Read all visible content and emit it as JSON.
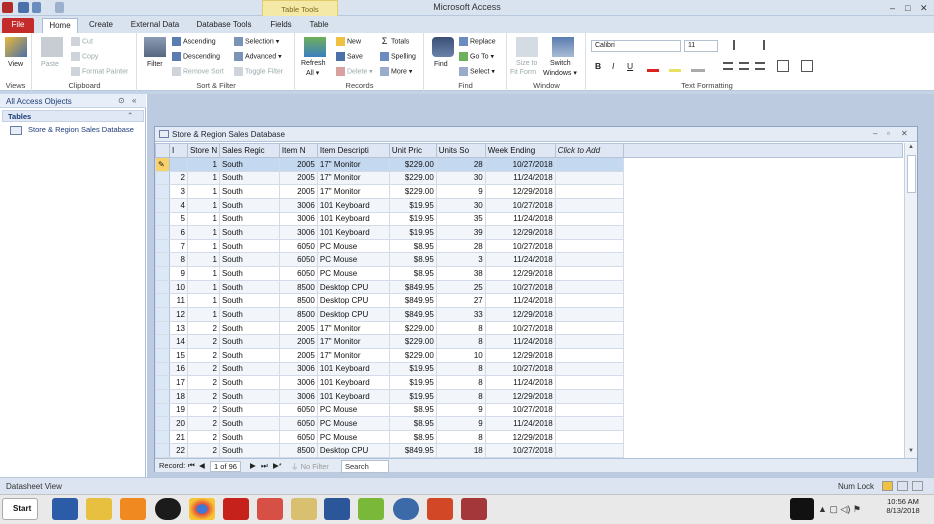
{
  "app": {
    "title": "Microsoft Access",
    "context_tab_group": "Table Tools"
  },
  "tabs": [
    "File",
    "Home",
    "Create",
    "External Data",
    "Database Tools",
    "Fields",
    "Table"
  ],
  "ribbon": {
    "views": {
      "label": "Views",
      "view": "View"
    },
    "clipboard": {
      "label": "Clipboard",
      "paste": "Paste",
      "cut": "Cut",
      "copy": "Copy",
      "format_painter": "Format Painter"
    },
    "sort_filter": {
      "label": "Sort & Filter",
      "filter": "Filter",
      "ascending": "Ascending",
      "descending": "Descending",
      "remove_sort": "Remove Sort",
      "selection": "Selection ▾",
      "advanced": "Advanced ▾",
      "toggle_filter": "Toggle Filter"
    },
    "records": {
      "label": "Records",
      "refresh": "Refresh",
      "refresh2": "All ▾",
      "new": "New",
      "save": "Save",
      "delete": "Delete ▾",
      "totals": "Totals",
      "spelling": "Spelling",
      "more": "More ▾"
    },
    "find": {
      "label": "Find",
      "find": "Find",
      "replace": "Replace",
      "goto": "Go To ▾",
      "select": "Select ▾"
    },
    "window": {
      "label": "Window",
      "size_to_fit": "Size to",
      "size_to_fit2": "Fit Form",
      "switch": "Switch",
      "switch2": "Windows ▾"
    },
    "text_formatting": {
      "label": "Text Formatting",
      "font": "Calibri",
      "size": "11",
      "bold": "B",
      "italic": "I",
      "underline": "U"
    }
  },
  "nav": {
    "header": "All Access Objects",
    "section": "Tables",
    "items": [
      "Store & Region Sales Database"
    ]
  },
  "document": {
    "title": "Store & Region Sales Database"
  },
  "grid": {
    "columns": [
      "I",
      "Store N",
      "Sales Regic",
      "Item N",
      "Item Descripti",
      "Unit Pric",
      "Units So",
      "Week Ending",
      "Click to Add"
    ],
    "rows": [
      [
        "",
        "1",
        "South",
        "2005",
        "17\" Monitor",
        "$229.00",
        "28",
        "10/27/2018"
      ],
      [
        "2",
        "1",
        "South",
        "2005",
        "17\" Monitor",
        "$229.00",
        "30",
        "11/24/2018"
      ],
      [
        "3",
        "1",
        "South",
        "2005",
        "17\" Monitor",
        "$229.00",
        "9",
        "12/29/2018"
      ],
      [
        "4",
        "1",
        "South",
        "3006",
        "101 Keyboard",
        "$19.95",
        "30",
        "10/27/2018"
      ],
      [
        "5",
        "1",
        "South",
        "3006",
        "101 Keyboard",
        "$19.95",
        "35",
        "11/24/2018"
      ],
      [
        "6",
        "1",
        "South",
        "3006",
        "101 Keyboard",
        "$19.95",
        "39",
        "12/29/2018"
      ],
      [
        "7",
        "1",
        "South",
        "6050",
        "PC Mouse",
        "$8.95",
        "28",
        "10/27/2018"
      ],
      [
        "8",
        "1",
        "South",
        "6050",
        "PC Mouse",
        "$8.95",
        "3",
        "11/24/2018"
      ],
      [
        "9",
        "1",
        "South",
        "6050",
        "PC Mouse",
        "$8.95",
        "38",
        "12/29/2018"
      ],
      [
        "10",
        "1",
        "South",
        "8500",
        "Desktop CPU",
        "$849.95",
        "25",
        "10/27/2018"
      ],
      [
        "11",
        "1",
        "South",
        "8500",
        "Desktop CPU",
        "$849.95",
        "27",
        "11/24/2018"
      ],
      [
        "12",
        "1",
        "South",
        "8500",
        "Desktop CPU",
        "$849.95",
        "33",
        "12/29/2018"
      ],
      [
        "13",
        "2",
        "South",
        "2005",
        "17\" Monitor",
        "$229.00",
        "8",
        "10/27/2018"
      ],
      [
        "14",
        "2",
        "South",
        "2005",
        "17\" Monitor",
        "$229.00",
        "8",
        "11/24/2018"
      ],
      [
        "15",
        "2",
        "South",
        "2005",
        "17\" Monitor",
        "$229.00",
        "10",
        "12/29/2018"
      ],
      [
        "16",
        "2",
        "South",
        "3006",
        "101 Keyboard",
        "$19.95",
        "8",
        "10/27/2018"
      ],
      [
        "17",
        "2",
        "South",
        "3006",
        "101 Keyboard",
        "$19.95",
        "8",
        "11/24/2018"
      ],
      [
        "18",
        "2",
        "South",
        "3006",
        "101 Keyboard",
        "$19.95",
        "8",
        "12/29/2018"
      ],
      [
        "19",
        "2",
        "South",
        "6050",
        "PC Mouse",
        "$8.95",
        "9",
        "10/27/2018"
      ],
      [
        "20",
        "2",
        "South",
        "6050",
        "PC Mouse",
        "$8.95",
        "9",
        "11/24/2018"
      ],
      [
        "21",
        "2",
        "South",
        "6050",
        "PC Mouse",
        "$8.95",
        "8",
        "12/29/2018"
      ],
      [
        "22",
        "2",
        "South",
        "8500",
        "Desktop CPU",
        "$849.95",
        "18",
        "10/27/2018"
      ]
    ]
  },
  "recnav": {
    "record_label": "Record:",
    "position": "1 of 96",
    "no_filter": "No Filter",
    "search": "Search"
  },
  "status": {
    "left": "Datasheet View",
    "num_lock": "Num Lock"
  },
  "taskbar": {
    "start": "Start",
    "time": "10:56 AM",
    "date": "8/13/2018"
  }
}
